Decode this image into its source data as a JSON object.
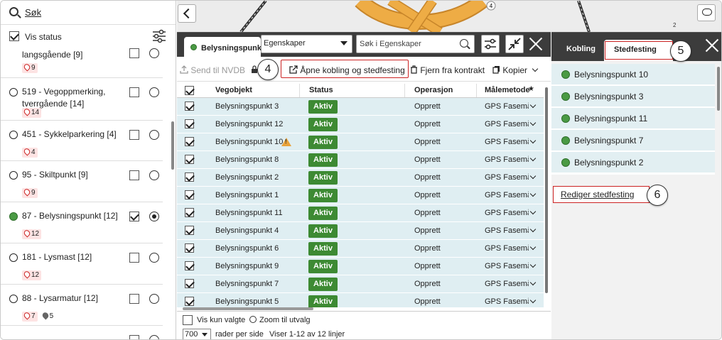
{
  "left_panel": {
    "search_label": "Søk",
    "vis_status_label": "Vis status",
    "layers": [
      {
        "name": "langsgående [9]",
        "badges": [
          {
            "type": "pin",
            "count": "9"
          }
        ],
        "checked": false,
        "selected": false,
        "dot": "none"
      },
      {
        "name": "519 - Vegoppmerking, tverrgående [14]",
        "badges": [
          {
            "type": "pin",
            "count": "14"
          }
        ],
        "checked": false,
        "selected": false,
        "dot": "empty"
      },
      {
        "name": "451 - Sykkelparkering [4]",
        "badges": [
          {
            "type": "pin",
            "count": "4"
          }
        ],
        "checked": false,
        "selected": false,
        "dot": "empty"
      },
      {
        "name": "95 - Skiltpunkt [9]",
        "badges": [
          {
            "type": "pin",
            "count": "9"
          }
        ],
        "checked": false,
        "selected": false,
        "dot": "empty"
      },
      {
        "name": "87 - Belysningspunkt [12]",
        "badges": [
          {
            "type": "pin",
            "count": "12"
          }
        ],
        "checked": true,
        "selected": true,
        "dot": "green"
      },
      {
        "name": "181 - Lysmast [12]",
        "badges": [
          {
            "type": "pin",
            "count": "12"
          }
        ],
        "checked": false,
        "selected": false,
        "dot": "empty"
      },
      {
        "name": "88 - Lysarmatur [12]",
        "badges": [
          {
            "type": "pin",
            "count": "7"
          },
          {
            "type": "grey",
            "count": "5"
          }
        ],
        "checked": false,
        "selected": false,
        "dot": "empty"
      }
    ]
  },
  "map": {
    "marker_4": "4",
    "marker_2": "2"
  },
  "main_panel": {
    "tab_label": "Belysningspunkt",
    "egenskaper_select": "Egenskaper",
    "search_placeholder": "Søk i Egenskaper",
    "toolbar": {
      "send_nvdb": "Send til NVDB",
      "open_link": "Åpne kobling og stedfesting",
      "remove_contract": "Fjern fra kontrakt",
      "copy": "Kopier"
    },
    "columns": [
      "Vegobjekt",
      "Status",
      "Operasjon",
      "Målemetode"
    ],
    "rows": [
      {
        "vegobjekt": "Belysningspunkt 3",
        "status": "Aktiv",
        "operasjon": "Opprett",
        "malemetode": "GPS Fasemåling",
        "warning": false
      },
      {
        "vegobjekt": "Belysningspunkt 12",
        "status": "Aktiv",
        "operasjon": "Opprett",
        "malemetode": "GPS Fasemåling",
        "warning": false
      },
      {
        "vegobjekt": "Belysningspunkt 10",
        "status": "Aktiv",
        "operasjon": "Opprett",
        "malemetode": "GPS Fasemåling",
        "warning": true
      },
      {
        "vegobjekt": "Belysningspunkt 8",
        "status": "Aktiv",
        "operasjon": "Opprett",
        "malemetode": "GPS Fasemåling",
        "warning": false
      },
      {
        "vegobjekt": "Belysningspunkt 2",
        "status": "Aktiv",
        "operasjon": "Opprett",
        "malemetode": "GPS Fasemåling",
        "warning": false
      },
      {
        "vegobjekt": "Belysningspunkt 1",
        "status": "Aktiv",
        "operasjon": "Opprett",
        "malemetode": "GPS Fasemåling",
        "warning": false
      },
      {
        "vegobjekt": "Belysningspunkt 11",
        "status": "Aktiv",
        "operasjon": "Opprett",
        "malemetode": "GPS Fasemåling",
        "warning": false
      },
      {
        "vegobjekt": "Belysningspunkt 4",
        "status": "Aktiv",
        "operasjon": "Opprett",
        "malemetode": "GPS Fasemåling",
        "warning": false
      },
      {
        "vegobjekt": "Belysningspunkt 6",
        "status": "Aktiv",
        "operasjon": "Opprett",
        "malemetode": "GPS Fasemåling",
        "warning": false
      },
      {
        "vegobjekt": "Belysningspunkt 9",
        "status": "Aktiv",
        "operasjon": "Opprett",
        "malemetode": "GPS Fasemåling",
        "warning": false
      },
      {
        "vegobjekt": "Belysningspunkt 7",
        "status": "Aktiv",
        "operasjon": "Opprett",
        "malemetode": "GPS Fasemåling",
        "warning": false
      },
      {
        "vegobjekt": "Belysningspunkt 5",
        "status": "Aktiv",
        "operasjon": "Opprett",
        "malemetode": "GPS Fasemåling",
        "warning": false
      }
    ],
    "footer": {
      "show_selected": "Vis kun valgte",
      "zoom": "Zoom til utvalg",
      "rows_value": "700",
      "rows_per_page": "rader per side",
      "showing": "Viser 1-12 av 12 linjer"
    }
  },
  "right_panel": {
    "tab_kobling": "Kobling",
    "tab_stedfesting": "Stedfesting",
    "items": [
      "Belysningspunkt 10",
      "Belysningspunkt 3",
      "Belysningspunkt 11",
      "Belysningspunkt 7",
      "Belysningspunkt 2"
    ],
    "edit_link": "Rediger stedfesting"
  },
  "callouts": {
    "c4": "4",
    "c5": "5",
    "c6": "6"
  },
  "colors": {
    "accent_green": "#3d8a33",
    "highlight_red": "#cc2222",
    "tab_bar": "#3c3c3c",
    "row_bg": "#dfeef2"
  }
}
